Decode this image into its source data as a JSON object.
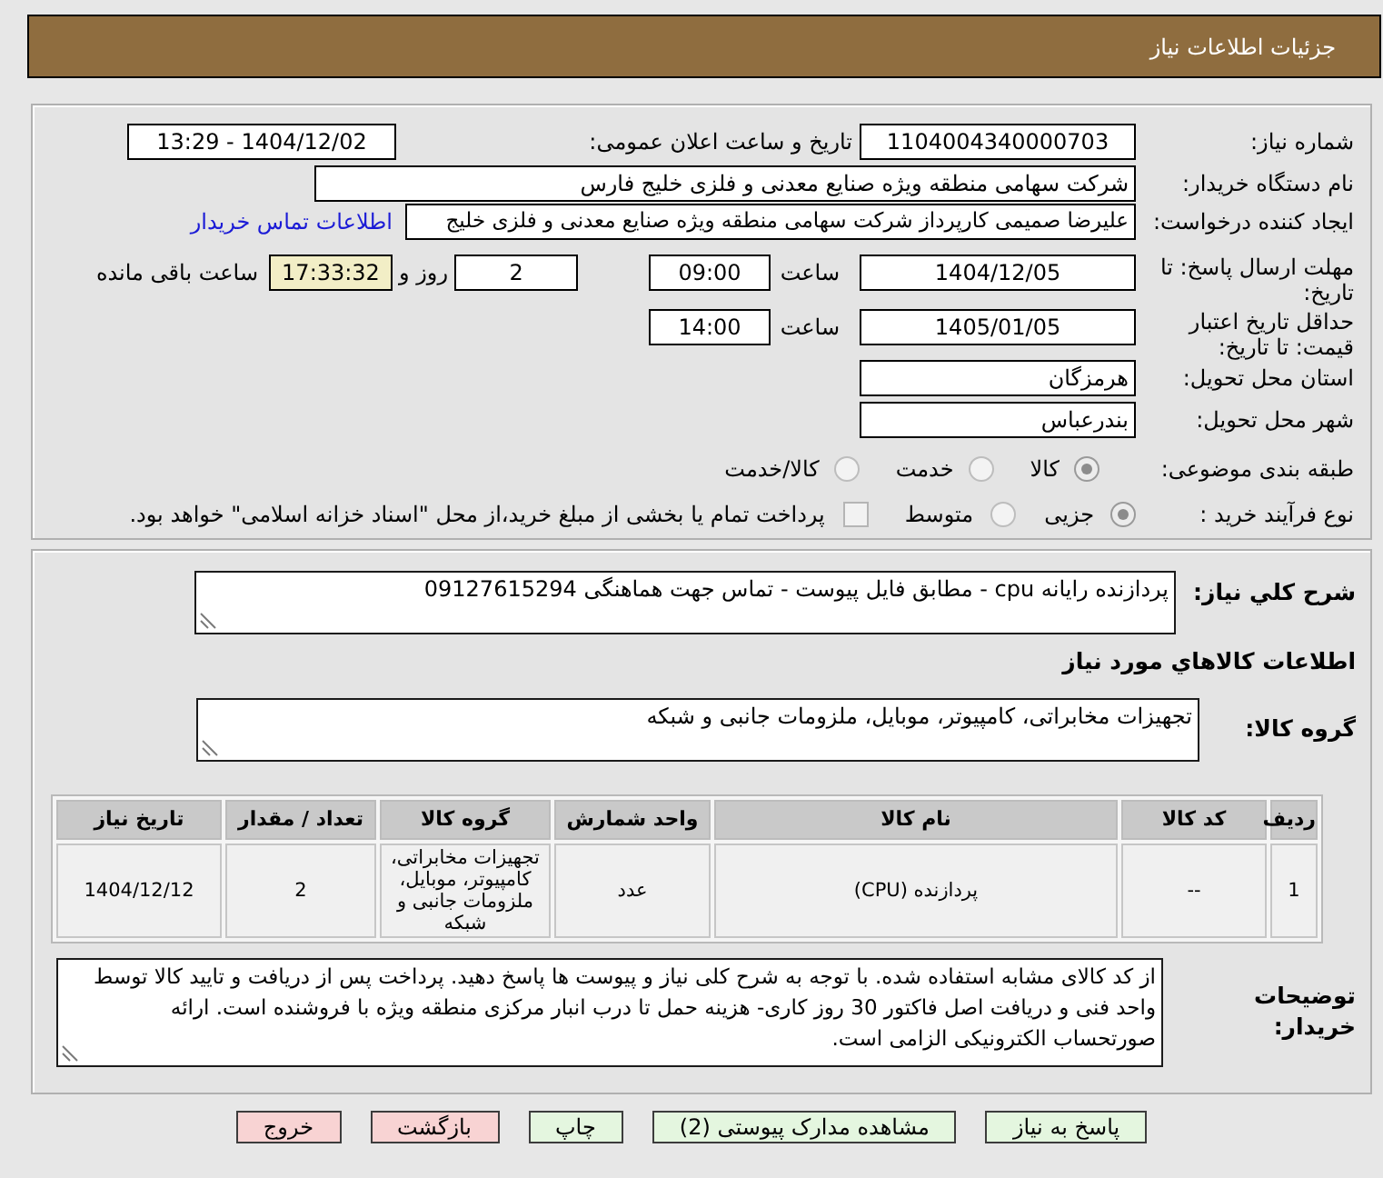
{
  "header": {
    "title": "جزئیات اطلاعات نیاز"
  },
  "details": {
    "need_number": {
      "label": "شماره نیاز:",
      "value": "1104004340000703"
    },
    "announce": {
      "label": "تاریخ و ساعت اعلان عمومی:",
      "value": "1404/12/02 - 13:29"
    },
    "buyer": {
      "label": "نام دستگاه خریدار:",
      "value": "شرکت سهامی منطقه ویژه صنایع معدنی و فلزی خلیج فارس"
    },
    "requester": {
      "label": "ایجاد کننده درخواست:",
      "value": "علیرضا صمیمی کارپرداز شرکت سهامی منطقه ویژه صنایع معدنی و فلزی خلیج",
      "link": "اطلاعات تماس خریدار"
    },
    "deadline": {
      "label": "مهلت ارسال پاسخ: تا تاریخ:",
      "date": "1404/12/05",
      "time_label": "ساعت",
      "time": "09:00",
      "days": "2",
      "days_label": "روز و",
      "remaining": "17:33:32",
      "remaining_label": "ساعت باقی مانده"
    },
    "validity": {
      "label": "حداقل تاریخ اعتبار قیمت: تا تاریخ:",
      "date": "1405/01/05",
      "time_label": "ساعت",
      "time": "14:00"
    },
    "province": {
      "label": "استان محل تحویل:",
      "value": "هرمزگان"
    },
    "city": {
      "label": "شهر محل تحویل:",
      "value": "بندرعباس"
    },
    "category": {
      "label": "طبقه بندی موضوعی:",
      "options": [
        {
          "label": "کالا",
          "selected": true
        },
        {
          "label": "خدمت",
          "selected": false
        },
        {
          "label": "کالا/خدمت",
          "selected": false
        }
      ]
    },
    "process": {
      "label": "نوع فرآیند خرید :",
      "options": [
        {
          "label": "جزیی",
          "selected": true
        },
        {
          "label": "متوسط",
          "selected": false
        }
      ],
      "treasury": {
        "checked": false,
        "label": "پرداخت تمام یا بخشی از مبلغ خرید،از محل \"اسناد خزانه اسلامی\" خواهد بود."
      }
    }
  },
  "description": {
    "label": "شرح کلي نياز:",
    "value": "پردازنده رایانه cpu - مطابق فایل پیوست - تماس جهت هماهنگی 09127615294"
  },
  "items_title": "اطلاعات کالاهاي مورد نياز",
  "goods_group": {
    "label": "گروه کالا:",
    "value": "تجهیزات مخابراتی، کامپیوتر، موبایل، ملزومات جانبی و شبکه"
  },
  "table": {
    "columns": [
      "ردیف",
      "کد کالا",
      "نام کالا",
      "واحد شمارش",
      "گروه کالا",
      "تعداد / مقدار",
      "تاریخ نیاز"
    ],
    "rows": [
      [
        "1",
        "--",
        "پردازنده (CPU)",
        "عدد",
        "تجهیزات مخابراتی، کامپیوتر، موبایل، ملزومات جانبی و شبکه",
        "2",
        "1404/12/12"
      ]
    ]
  },
  "buyer_notes": {
    "label": "توضیحات خریدار:",
    "value": "از کد کالای مشابه استفاده شده. با توجه به شرح کلی نیاز و پیوست ها پاسخ دهید. پرداخت پس از دریافت و تایید کالا توسط واحد فنی و دریافت اصل فاکتور 30 روز کاری- هزینه حمل تا درب انبار مرکزی منطقه ویژه با فروشنده است. ارائه صورتحساب الکترونیکی الزامی است."
  },
  "buttons": [
    {
      "label": "پاسخ به نیاز",
      "kind": "normal"
    },
    {
      "label": "مشاهده مدارک پیوستی (2)",
      "kind": "normal"
    },
    {
      "label": "چاپ",
      "kind": "normal"
    },
    {
      "label": "بازگشت",
      "kind": "danger"
    },
    {
      "label": "خروج",
      "kind": "danger"
    }
  ]
}
